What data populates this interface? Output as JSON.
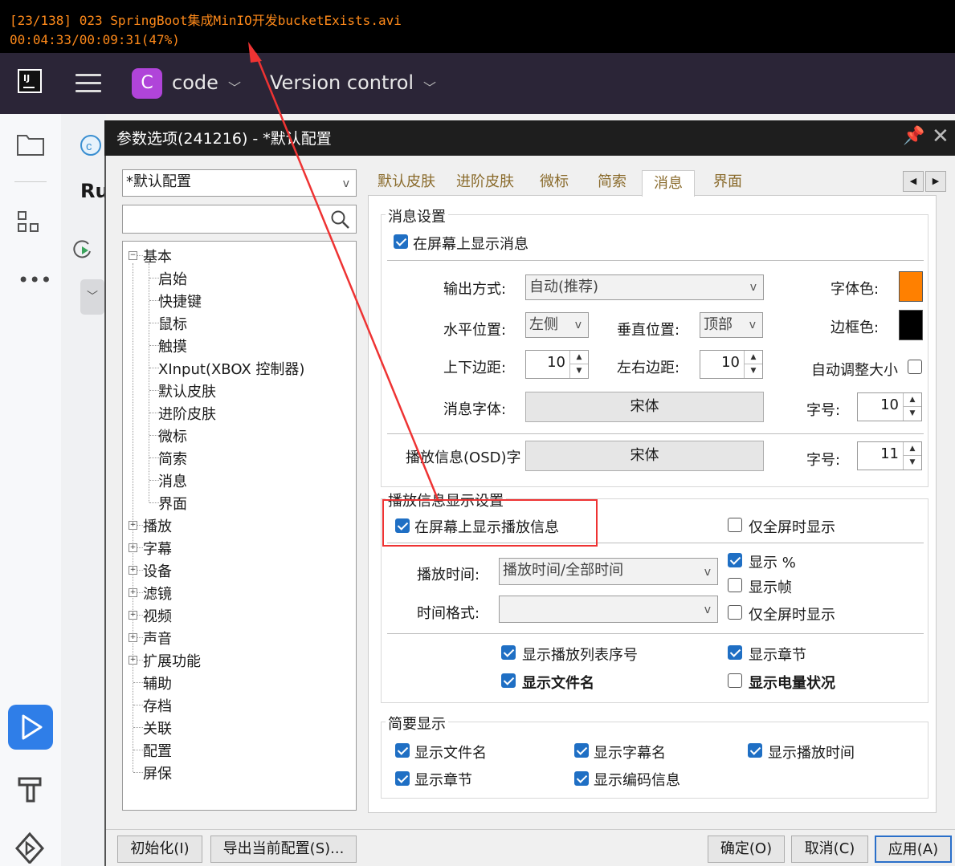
{
  "osd": {
    "line1": "[23/138] 023 SpringBoot集成MinIO开发bucketExists.avi",
    "line2": "00:04:33/00:09:31(47%)"
  },
  "ide": {
    "logo_text": "IJ",
    "project_badge": "C",
    "project_name": "code",
    "vcs": "Version control",
    "strip_label": "Ru",
    "accent": "#b044d9"
  },
  "dialog": {
    "title": "参数选项(241216) - *默认配置",
    "profile": "*默认配置",
    "search_value": "",
    "tree": [
      {
        "label": "基本",
        "expander": "⊟"
      },
      {
        "label": "启始"
      },
      {
        "label": "快捷键"
      },
      {
        "label": "鼠标"
      },
      {
        "label": "触摸"
      },
      {
        "label": "XInput(XBOX 控制器)"
      },
      {
        "label": "默认皮肤"
      },
      {
        "label": "进阶皮肤"
      },
      {
        "label": "微标"
      },
      {
        "label": "简索"
      },
      {
        "label": "消息"
      },
      {
        "label": "界面"
      },
      {
        "label": "播放",
        "expander": "⊞"
      },
      {
        "label": "字幕",
        "expander": "⊞"
      },
      {
        "label": "设备",
        "expander": "⊞"
      },
      {
        "label": "滤镜",
        "expander": "⊞"
      },
      {
        "label": "视频",
        "expander": "⊞"
      },
      {
        "label": "声音",
        "expander": "⊞"
      },
      {
        "label": "扩展功能",
        "expander": "⊞"
      },
      {
        "label": "辅助"
      },
      {
        "label": "存档"
      },
      {
        "label": "关联"
      },
      {
        "label": "配置"
      },
      {
        "label": "屏保"
      }
    ],
    "tabs": [
      "默认皮肤",
      "进阶皮肤",
      "微标",
      "简索",
      "消息",
      "界面"
    ],
    "tab_nav": {
      "left": "◀",
      "right": "▶"
    },
    "msg": {
      "group_title": "消息设置",
      "show_on_screen": "在屏幕上显示消息",
      "output_label": "输出方式:",
      "output_value": "自动(推荐)",
      "font_color_label": "字体色:",
      "font_color": "#ff8000",
      "border_color_label": "边框色:",
      "border_color": "#000000",
      "hpos_label": "水平位置:",
      "hpos_value": "左侧",
      "vpos_label": "垂直位置:",
      "vpos_value": "顶部",
      "vmargin_label": "上下边距:",
      "vmargin_value": "10",
      "hmargin_label": "左右边距:",
      "hmargin_value": "10",
      "autosize_label": "自动调整大小",
      "font_label": "消息字体:",
      "font_value": "宋体",
      "size_label": "字号:",
      "size_value": "10",
      "osd_font_label": "播放信息(OSD)字",
      "osd_font_value": "宋体",
      "osd_size_label": "字号:",
      "osd_size_value": "11"
    },
    "play": {
      "group_title": "播放信息显示设置",
      "show_play_info": "在屏幕上显示播放信息",
      "fullscreen_only": "仅全屏时显示",
      "time_label": "播放时间:",
      "time_value": "播放时间/全部时间",
      "show_percent": "显示 %",
      "show_frame": "显示帧",
      "format_label": "时间格式:",
      "format_value": "",
      "fullscreen_only2": "仅全屏时显示",
      "show_playlist_no": "显示播放列表序号",
      "show_chapter": "显示章节",
      "show_filename": "显示文件名",
      "show_battery": "显示电量状况"
    },
    "brief": {
      "group_title": "简要显示",
      "show_filename": "显示文件名",
      "show_subtitle": "显示字幕名",
      "show_playtime": "显示播放时间",
      "show_chapter": "显示章节",
      "show_codec": "显示编码信息"
    },
    "footer": {
      "init": "初始化(I)",
      "export": "导出当前配置(S)...",
      "ok": "确定(O)",
      "cancel": "取消(C)",
      "apply": "应用(A)"
    }
  }
}
